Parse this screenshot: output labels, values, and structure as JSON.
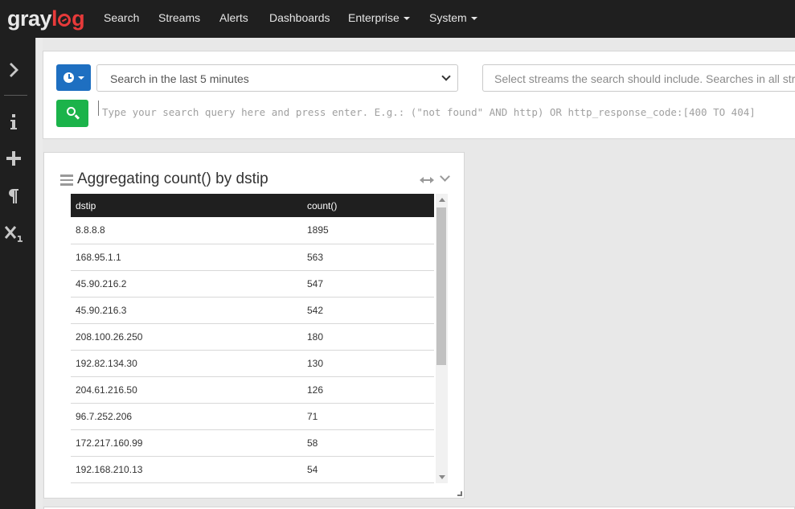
{
  "nav": {
    "logo_a": "gray",
    "logo_b": "l",
    "logo_c": "g",
    "items": [
      "Search",
      "Streams",
      "Alerts",
      "Dashboards",
      "Enterprise",
      "System"
    ]
  },
  "sidebar": {
    "icons": [
      "chevron-right-icon",
      "info-icon",
      "plus-icon",
      "paragraph-icon",
      "subscript-icon"
    ]
  },
  "search": {
    "time_range": "Search in the last 5 minutes",
    "streams_placeholder": "Select streams the search should include. Searches in all streams if empty.",
    "query_placeholder": "Type your search query here and press enter. E.g.: (\"not found\" AND http) OR http_response_code:[400 TO 404]"
  },
  "widget": {
    "title": "Aggregating count() by dstip",
    "columns": [
      "dstip",
      "count()"
    ],
    "rows": [
      [
        "8.8.8.8",
        "1895"
      ],
      [
        "168.95.1.1",
        "563"
      ],
      [
        "45.90.216.2",
        "547"
      ],
      [
        "45.90.216.3",
        "542"
      ],
      [
        "208.100.26.250",
        "180"
      ],
      [
        "192.82.134.30",
        "130"
      ],
      [
        "204.61.216.50",
        "126"
      ],
      [
        "96.7.252.206",
        "71"
      ],
      [
        "172.217.160.99",
        "58"
      ],
      [
        "192.168.210.13",
        "54"
      ]
    ]
  },
  "colors": {
    "nav_bg": "#1f1f1f",
    "primary": "#1e6fc1",
    "success": "#1bb34a",
    "logo_red": "#e73a3a"
  }
}
